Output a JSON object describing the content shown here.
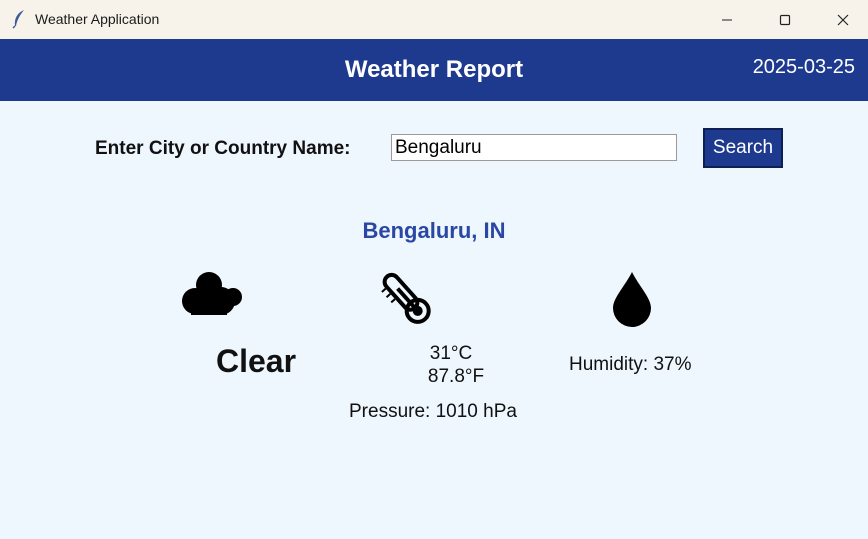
{
  "window": {
    "title": "Weather Application",
    "icons": {
      "app": "feather-icon",
      "minimize": "minimize-icon",
      "maximize": "maximize-icon",
      "close": "close-icon"
    }
  },
  "header": {
    "title": "Weather Report",
    "date": "2025-03-25",
    "background": "#1e3a8f"
  },
  "search": {
    "label": "Enter City or Country Name:",
    "value": "Bengaluru",
    "button_label": "Search"
  },
  "weather": {
    "location": "Bengaluru, IN",
    "condition": "Clear",
    "temp_c": "31°C",
    "temp_f": "87.8°F",
    "humidity": "Humidity: 37%",
    "pressure": "Pressure: 1010 hPa",
    "icons": {
      "condition": "cloud-icon",
      "temperature": "thermometer-icon",
      "humidity": "water-drop-icon"
    }
  },
  "colors": {
    "accent": "#1e3a8f",
    "location_text": "#2a48a3",
    "background": "#eef6fe"
  }
}
